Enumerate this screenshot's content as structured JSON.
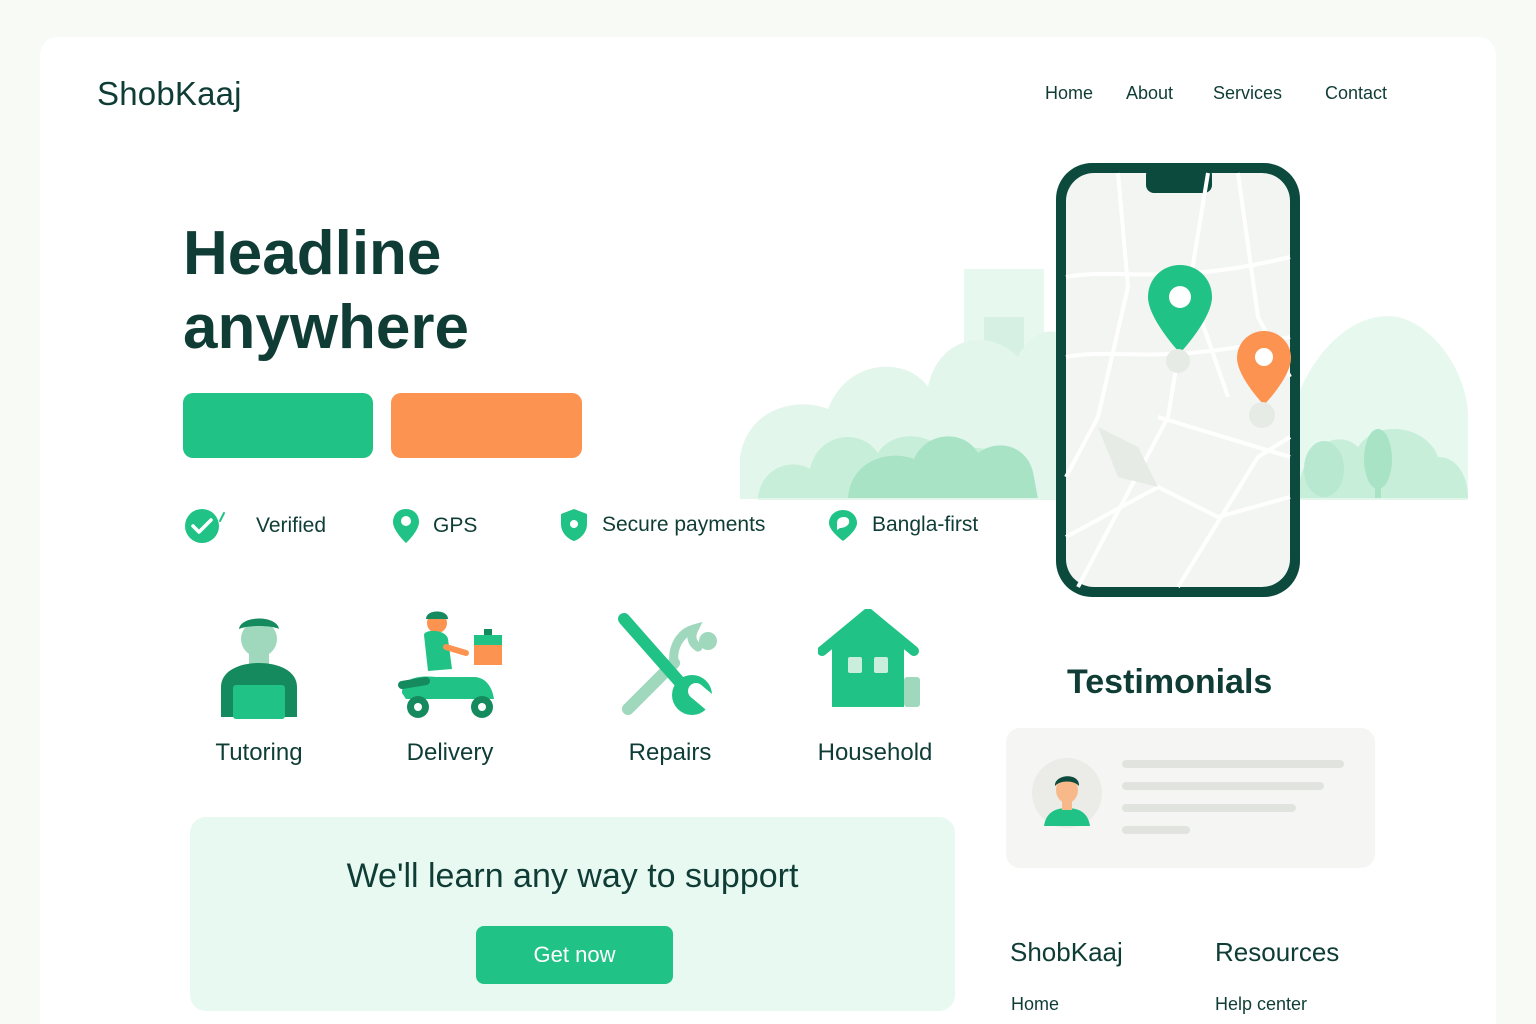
{
  "brand": {
    "name": "ShobKaaj"
  },
  "nav": {
    "items": [
      "Home",
      "About",
      "Services",
      "Contact"
    ]
  },
  "hero": {
    "headline_line1": "Headline",
    "headline_line2": "anywhere"
  },
  "features": [
    {
      "label": "Verified",
      "icon": "check-circle-icon"
    },
    {
      "label": "GPS",
      "icon": "map-pin-icon"
    },
    {
      "label": "Secure payments",
      "icon": "shield-icon"
    },
    {
      "label": "Bangla-first",
      "icon": "chat-pin-icon"
    }
  ],
  "services": [
    {
      "label": "Tutoring",
      "icon": "tutor-icon"
    },
    {
      "label": "Delivery",
      "icon": "delivery-scooter-icon"
    },
    {
      "label": "Repairs",
      "icon": "wrench-screwdriver-icon"
    },
    {
      "label": "Household",
      "icon": "house-icon"
    }
  ],
  "cta": {
    "title": "We'll learn any way to support",
    "button": "Get now"
  },
  "testimonials": {
    "title": "Testimonials"
  },
  "footer": {
    "col1": {
      "heading": "ShobKaaj",
      "link": "Home"
    },
    "col2": {
      "heading": "Resources",
      "link": "Help center"
    }
  },
  "colors": {
    "primary": "#21c285",
    "accent": "#fd9350",
    "text": "#0f3d36",
    "phone_frame": "#0d4a3e"
  }
}
